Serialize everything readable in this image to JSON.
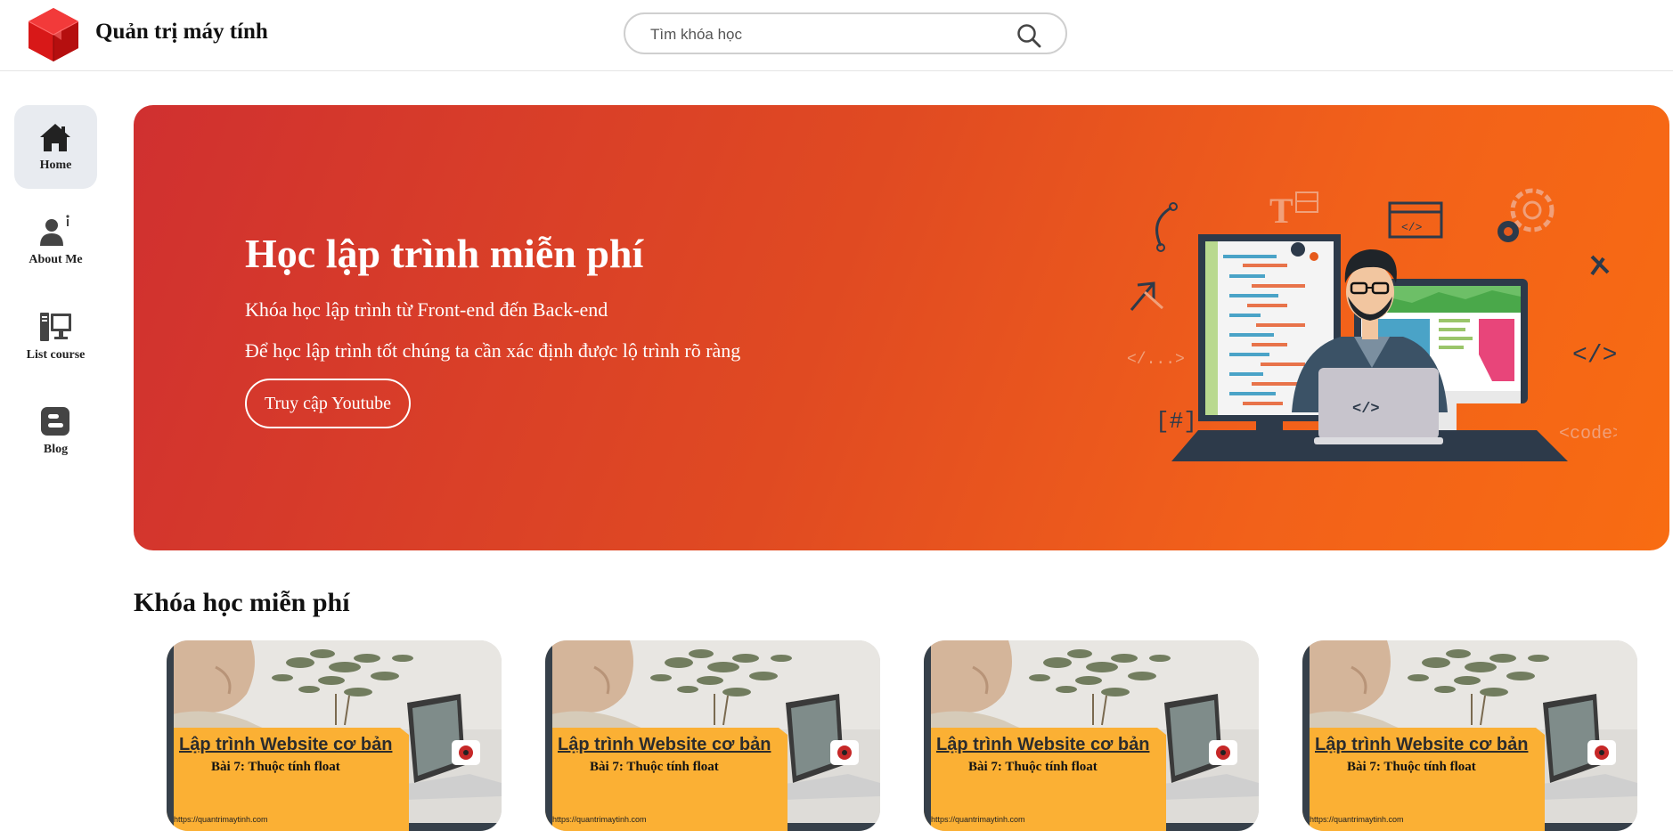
{
  "header": {
    "brand": "Quản trị máy tính",
    "search_placeholder": "Tìm khóa học",
    "search_icon": "search-icon"
  },
  "sidebar": {
    "items": [
      {
        "label": "Home",
        "icon": "home-icon",
        "active": true
      },
      {
        "label": "About Me",
        "icon": "user-info-icon"
      },
      {
        "label": "List course",
        "icon": "computer-icon"
      },
      {
        "label": "Blog",
        "icon": "blogger-icon"
      }
    ]
  },
  "banner": {
    "title": "Học lập trình miễn phí",
    "line1": "Khóa học lập trình từ Front-end đến Back-end",
    "line2": "Để học lập trình tốt chúng ta cần xác định được lộ trình rõ ràng",
    "button": "Truy cập Youtube",
    "illustration_labels": [
      "</...>",
      "[#]",
      "</>",
      "<code>",
      "</>"
    ]
  },
  "section": {
    "title": "Khóa học miễn phí"
  },
  "courses": [
    {
      "title": "Lập trình Website cơ bản",
      "subtitle": "Bài 7: Thuộc tính float",
      "url": "https://quantrimaytinh.com"
    },
    {
      "title": "Lập trình Website cơ bản",
      "subtitle": "Bài 7: Thuộc tính float",
      "url": "https://quantrimaytinh.com"
    },
    {
      "title": "Lập trình Website cơ bản",
      "subtitle": "Bài 7: Thuộc tính float",
      "url": "https://quantrimaytinh.com"
    },
    {
      "title": "Lập trình Website cơ bản",
      "subtitle": "Bài 7: Thuộc tính float",
      "url": "https://quantrimaytinh.com"
    }
  ],
  "colors": {
    "banner_start": "#d03030",
    "banner_end": "#f86c12",
    "card_label": "#fbb034",
    "logo": "#e01e1e"
  }
}
